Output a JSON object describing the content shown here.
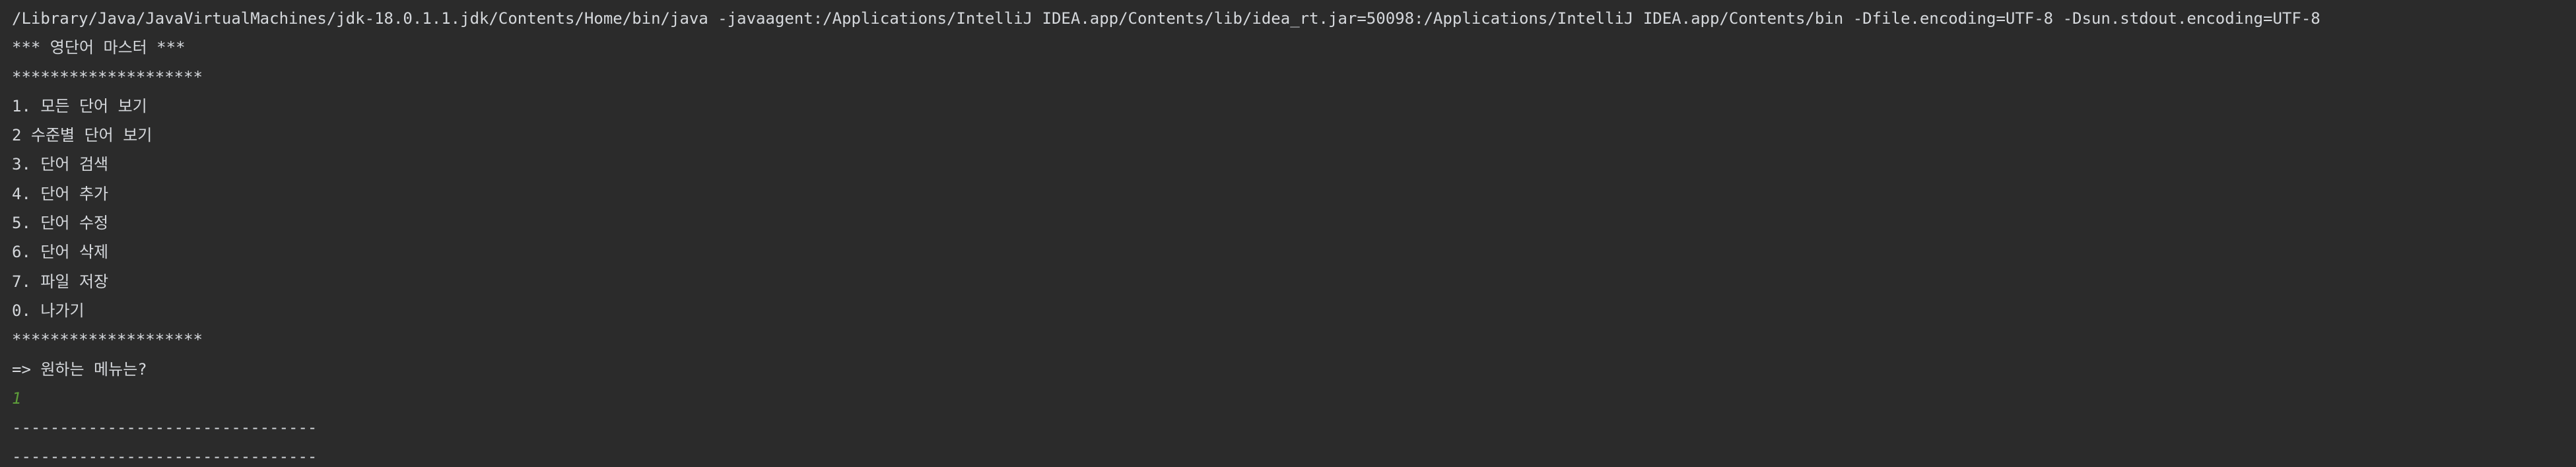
{
  "console": {
    "command": "/Library/Java/JavaVirtualMachines/jdk-18.0.1.1.jdk/Contents/Home/bin/java -javaagent:/Applications/IntelliJ IDEA.app/Contents/lib/idea_rt.jar=50098:/Applications/IntelliJ IDEA.app/Contents/bin -Dfile.encoding=UTF-8 -Dsun.stdout.encoding=UTF-8",
    "title": "*** 영단어 마스터 ***",
    "separator": "********************",
    "menu": [
      "1. 모든 단어 보기",
      "2 수준별 단어 보기",
      "3. 단어 검색",
      "4. 단어 추가",
      "5. 단어 수정",
      "6. 단어 삭제",
      "7. 파일 저장",
      "0. 나가기"
    ],
    "prompt": "=> 원하는 메뉴는?",
    "user_input": "1",
    "divider": "--------------------------------",
    "text_color": "#d5d8dc",
    "input_color": "#5e9e3a",
    "background": "#2b2b2b"
  }
}
